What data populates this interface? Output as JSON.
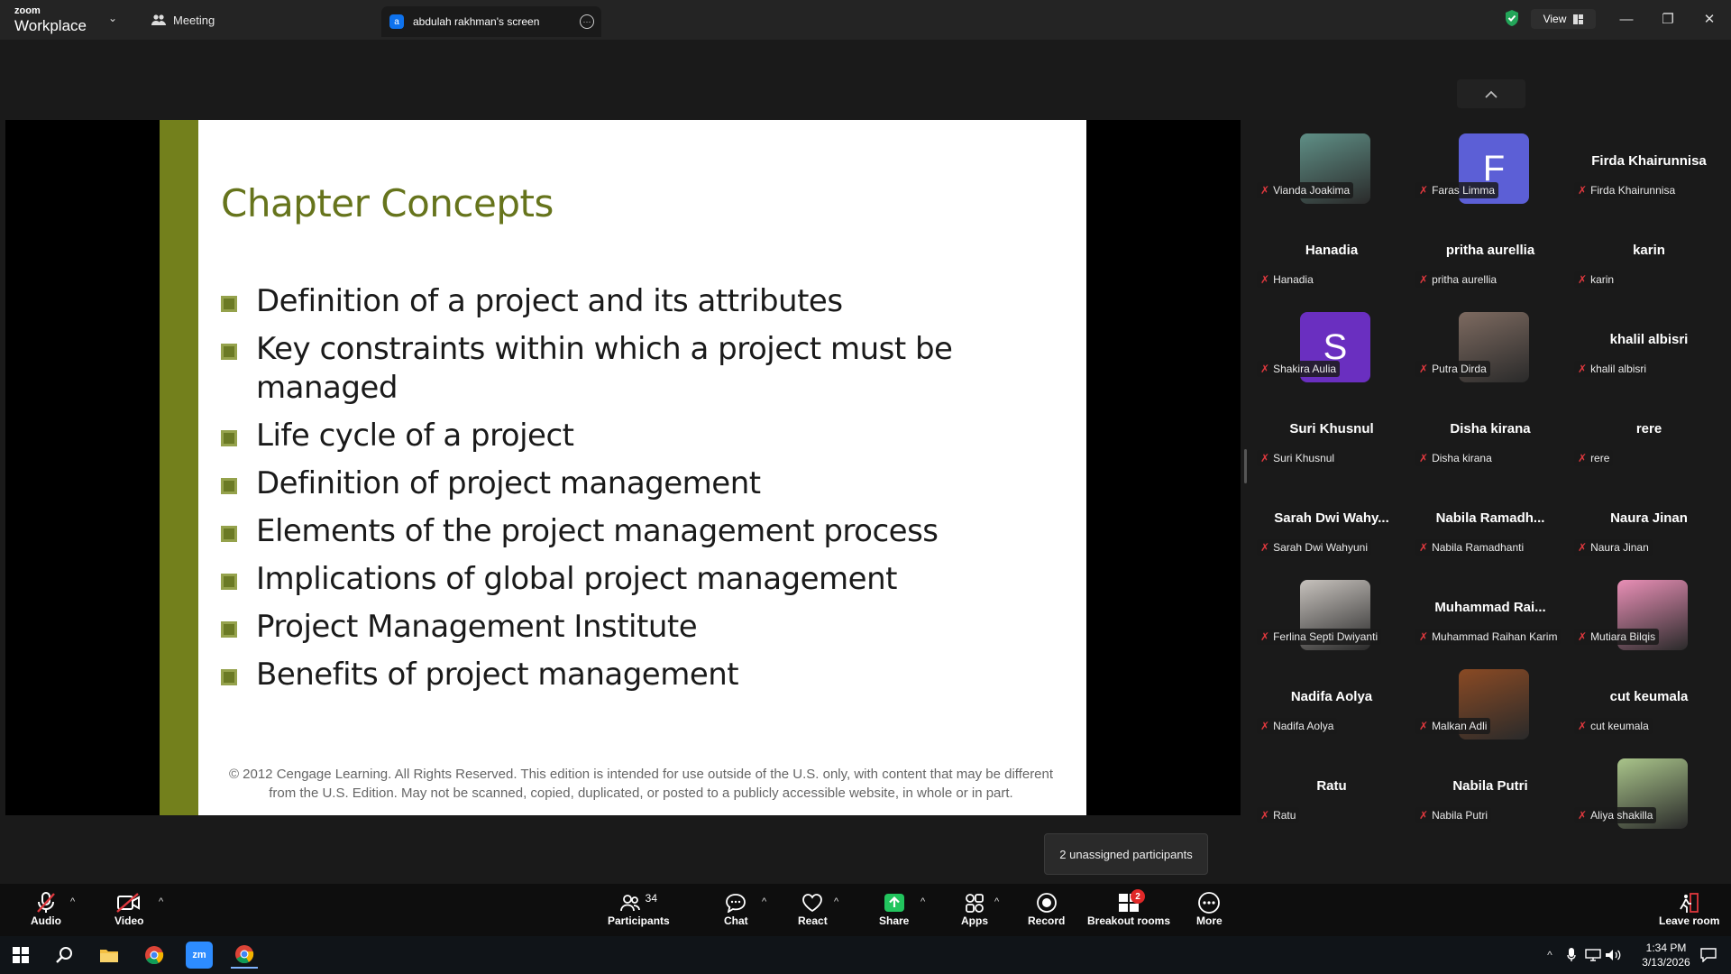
{
  "titlebar": {
    "logo_top": "zoom",
    "logo_bottom": "Workplace",
    "meeting_tab": "Meeting",
    "screen_tab_initial": "a",
    "screen_tab_label": "abdulah rakhman's screen",
    "view_label": "View"
  },
  "slide": {
    "title": "Chapter Concepts",
    "bullets": [
      "Definition of a project and its attributes",
      "Key constraints within which a project must be managed",
      "Life cycle of a project",
      "Definition of project management",
      "Elements of the project management process",
      "Implications of global project management",
      "Project Management Institute",
      "Benefits of project management"
    ],
    "copyright": "© 2012 Cengage Learning. All Rights Reserved. This edition is intended for use outside of the U.S. only, with content that may be different from the U.S. Edition. May not be scanned, copied, duplicated, or posted to a publicly accessible website, in whole or in part."
  },
  "participants": [
    {
      "display": "",
      "label": "Vianda Joakima",
      "avatar": "photo",
      "color": "#5f8f86"
    },
    {
      "display": "",
      "label": "Faras Limma",
      "avatar": "F",
      "color": "#5c5fd6"
    },
    {
      "display": "Firda Khairunnisa",
      "label": "Firda Khairunnisa"
    },
    {
      "display": "Hanadia",
      "label": "Hanadia"
    },
    {
      "display": "pritha aurellia",
      "label": "pritha aurellia"
    },
    {
      "display": "karin",
      "label": "karin"
    },
    {
      "display": "",
      "label": "Shakira Aulia",
      "avatar": "S",
      "color": "#6a2fc0"
    },
    {
      "display": "",
      "label": "Putra Dirda",
      "avatar": "photo",
      "color": "#7d6a60"
    },
    {
      "display": "khalil albisri",
      "label": "khalil albisri"
    },
    {
      "display": "Suri Khusnul",
      "label": "Suri Khusnul"
    },
    {
      "display": "Disha kirana",
      "label": "Disha kirana"
    },
    {
      "display": "rere",
      "label": "rere"
    },
    {
      "display": "Sarah Dwi Wahy...",
      "label": "Sarah Dwi Wahyuni"
    },
    {
      "display": "Nabila Ramadh...",
      "label": "Nabila Ramadhanti"
    },
    {
      "display": "Naura Jinan",
      "label": "Naura Jinan"
    },
    {
      "display": "",
      "label": "Ferlina Septi Dwiyanti",
      "avatar": "photo",
      "color": "#c7c2bd"
    },
    {
      "display": "Muhammad Rai...",
      "label": "Muhammad Raihan Karim"
    },
    {
      "display": "",
      "label": "Mutiara Bilqis",
      "avatar": "photo",
      "color": "#e98fb6"
    },
    {
      "display": "Nadifa Aolya",
      "label": "Nadifa Aolya"
    },
    {
      "display": "",
      "label": "Malkan Adli",
      "avatar": "photo",
      "color": "#8a4a24"
    },
    {
      "display": "cut keumala",
      "label": "cut keumala"
    },
    {
      "display": "Ratu",
      "label": "Ratu"
    },
    {
      "display": "Nabila Putri",
      "label": "Nabila Putri"
    },
    {
      "display": "",
      "label": "Aliya shakilla",
      "avatar": "photo",
      "color": "#a9c48a"
    }
  ],
  "tooltip": "2 unassigned participants",
  "toolbar": {
    "audio": "Audio",
    "video": "Video",
    "participants": "Participants",
    "participants_count": "34",
    "chat": "Chat",
    "react": "React",
    "share": "Share",
    "apps": "Apps",
    "record": "Record",
    "breakout": "Breakout rooms",
    "breakout_badge": "2",
    "more": "More",
    "leave": "Leave room"
  },
  "taskbar": {
    "time": "1:34 PM",
    "date": "3/13/2026"
  },
  "colors": {
    "slide_accent": "#73801c",
    "title_green": "#66741c",
    "mic_muted": "#e0383e",
    "share_green": "#22c55e",
    "badge_red": "#e02828"
  }
}
